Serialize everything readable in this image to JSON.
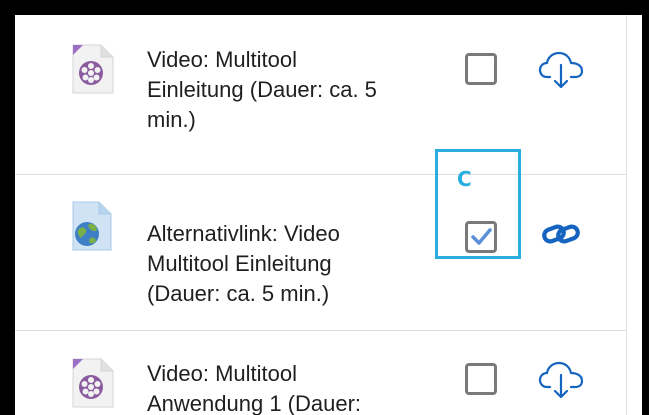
{
  "activities": [
    {
      "type_icon": "video-file-icon",
      "title": "Video: Multitool\nEinleitung (Dauer: ca. 5\nmin.)",
      "completed": false,
      "action_icon": "cloud-download-icon"
    },
    {
      "type_icon": "url-link-file-icon",
      "title": "Alternativlink: Video\nMultitool Einleitung\n(Dauer: ca. 5 min.)",
      "completed": true,
      "action_icon": "link-icon"
    },
    {
      "type_icon": "video-file-icon",
      "title": "Video: Multitool\nAnwendung 1 (Dauer:",
      "completed": false,
      "action_icon": "cloud-download-icon"
    }
  ],
  "annotation": {
    "label": "C",
    "color": "#29aee0"
  },
  "colors": {
    "accent": "#1565c0",
    "check": "#5b8fd9",
    "checkbox_border": "#7a7a7a",
    "text": "#1f1f1f"
  }
}
